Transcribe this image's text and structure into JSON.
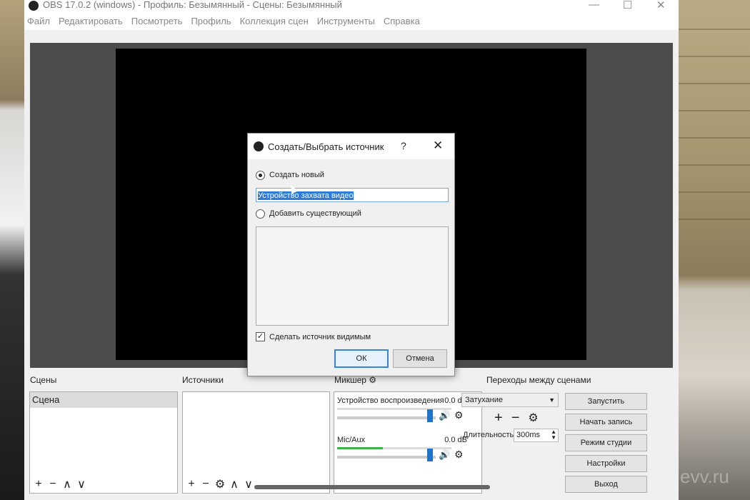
{
  "window": {
    "title": "OBS 17.0.2 (windows) - Профиль: Безымянный - Сцены: Безымянный",
    "controls": {
      "minimize": "—",
      "maximize": "☐",
      "close": "✕"
    }
  },
  "menu": [
    "Файл",
    "Редактировать",
    "Посмотреть",
    "Профиль",
    "Коллекция сцен",
    "Инструменты",
    "Справка"
  ],
  "docks": {
    "scenes_label": "Сцены",
    "sources_label": "Источники",
    "mixer_label": "Микшер",
    "transitions_label": "Переходы между сценами"
  },
  "scenes": [
    {
      "label": "Сцена"
    }
  ],
  "mixer": {
    "channels": [
      {
        "name": "Устройство воспроизведения",
        "db": "0.0 dB",
        "level": 0.0
      },
      {
        "name": "Mic/Aux",
        "db": "0.0 dB",
        "level": 0.4
      }
    ]
  },
  "transitions": {
    "selected": "Затухание",
    "duration_label": "Длительность",
    "duration_value": "300ms"
  },
  "controls": [
    {
      "label": "Запустить трансляцию"
    },
    {
      "label": "Начать запись"
    },
    {
      "label": "Режим студии"
    },
    {
      "label": "Настройки"
    },
    {
      "label": "Выход"
    }
  ],
  "dialog": {
    "title": "Создать/Выбрать источник",
    "help": "?",
    "close": "✕",
    "create_new_label": "Создать новый",
    "name_value": "Устройство захвата видео",
    "add_existing_label": "Добавить существующий",
    "make_visible_label": "Сделать источник видимым",
    "ok_label": "ОК",
    "cancel_label": "Отмена"
  },
  "watermark": "evv.ru"
}
